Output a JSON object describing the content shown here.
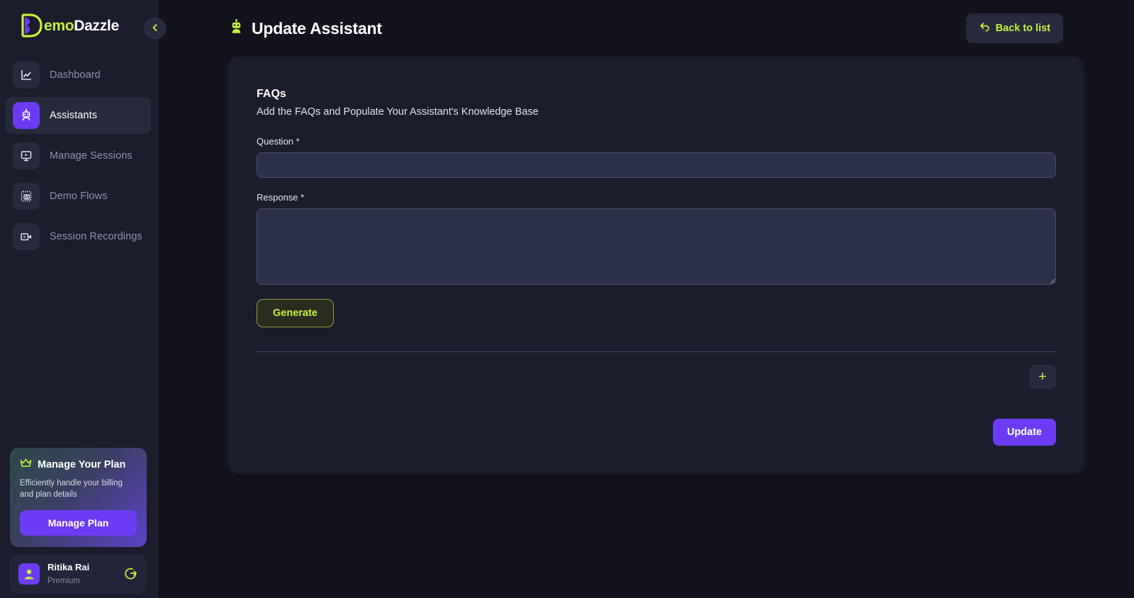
{
  "brand": {
    "name_part_1": "emo",
    "name_part_2": "Dazzle",
    "accent_lime": "#c6f03c",
    "accent_purple": "#6c3cf4"
  },
  "sidebar": {
    "items": [
      {
        "label": "Dashboard",
        "icon": "chart-line-icon",
        "active": false
      },
      {
        "label": "Assistants",
        "icon": "robot-icon",
        "active": true
      },
      {
        "label": "Manage Sessions",
        "icon": "monitor-play-icon",
        "active": false
      },
      {
        "label": "Demo Flows",
        "icon": "camera-frame-icon",
        "active": false
      },
      {
        "label": "Session Recordings",
        "icon": "video-camera-icon",
        "active": false
      }
    ],
    "collapse_tooltip": "Collapse sidebar",
    "plan_card": {
      "title": "Manage Your Plan",
      "description": "Efficiently handle your billing and plan details",
      "button_label": "Manage Plan",
      "icon": "crown-icon"
    },
    "user": {
      "name": "Ritika Rai",
      "plan": "Premium",
      "logout_icon": "logout-icon",
      "avatar_icon": "user-avatar-icon"
    }
  },
  "header": {
    "title": "Update Assistant",
    "title_icon": "robot-icon",
    "back_label": "Back to list",
    "back_icon": "undo-arrow-icon"
  },
  "form": {
    "section_title": "FAQs",
    "section_subtitle": "Add the FAQs and Populate Your Assistant's Knowledge Base",
    "question_label": "Question *",
    "question_value": "",
    "question_placeholder": "",
    "response_label": "Response *",
    "response_value": "",
    "response_placeholder": "",
    "generate_label": "Generate",
    "add_label": "+",
    "submit_label": "Update"
  }
}
